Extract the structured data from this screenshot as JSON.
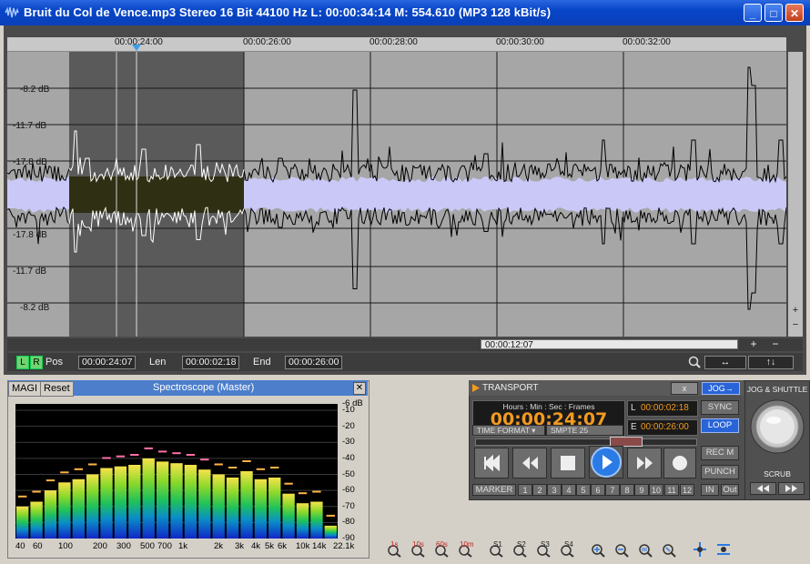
{
  "window": {
    "title": "Bruit du Col de Vence.mp3  Stereo 16 Bit 44100 Hz L: 00:00:34:14 M: 554.610  (MP3 128 kBit/s)",
    "minimize": "_",
    "maximize": "□",
    "close": "✕"
  },
  "ruler": {
    "ticks": [
      "00:00:24:00",
      "00:00:26:00",
      "00:00:28:00",
      "00:00:30:00",
      "00:00:32:00"
    ]
  },
  "waveform": {
    "db_labels": [
      "-8.2 dB",
      "-11.7 dB",
      "-17.8 dB",
      "-17.8 dB",
      "-11.7 dB",
      "-8.2 dB"
    ],
    "colors": {
      "background": "#a6a6a6",
      "selection": "#5a5a5a",
      "fill": "#c9c8f6",
      "selection_fill": "#2f2f14",
      "line": "#000000"
    }
  },
  "scroll": {
    "position": "00:00:12:07",
    "zoom_in": "+",
    "zoom_out": "−",
    "v_zoom_in": "+",
    "v_zoom_out": "−"
  },
  "infobar": {
    "left_channel": "L",
    "right_channel": "R",
    "pos_label": "Pos",
    "pos_value": "00:00:24:07",
    "len_label": "Len",
    "len_value": "00:00:02:18",
    "end_label": "End",
    "end_value": "00:00:26:00",
    "h_zoom": "↔",
    "v_zoom": "↑↓"
  },
  "spectroscope": {
    "tab_magi": "MAGI",
    "tab_reset": "Reset",
    "title": "Spectroscope (Master)",
    "close": "✕",
    "db_scale": [
      "-6 dB",
      "-10",
      "-20",
      "-30",
      "-40",
      "-50",
      "-60",
      "-70",
      "-80",
      "-90"
    ],
    "freq_labels": [
      "40",
      "60",
      "100",
      "200",
      "300",
      "500",
      "700",
      "1k",
      "2k",
      "3k",
      "4k",
      "5k",
      "6k",
      "10k",
      "14k",
      "22.1k"
    ],
    "levels_db": [
      -70,
      -67,
      -60,
      -55,
      -53,
      -50,
      -46,
      -45,
      -44,
      -40,
      -42,
      -43,
      -44,
      -47,
      -50,
      -52,
      -48,
      -53,
      -52,
      -62,
      -68,
      -67,
      -82
    ]
  },
  "transport": {
    "title": "TRANSPORT",
    "close": "x",
    "jog_button": "JOG→",
    "time_header": "Hours : Min : Sec : Frames",
    "time": "00:00:24:07",
    "time_format_label": "TIME FORMAT",
    "time_format_value": "SMPTE 25",
    "l_label": "L",
    "l_value": "00:00:02:18",
    "e_label": "E",
    "e_value": "00:00:26:00",
    "sync": "SYNC",
    "loop": "LOOP",
    "rec_m": "REC M",
    "punch": "PUNCH",
    "in": "IN",
    "out": "Out",
    "marker": "MARKER",
    "markers": [
      "1",
      "2",
      "3",
      "4",
      "5",
      "6",
      "7",
      "8",
      "9",
      "10",
      "11",
      "12"
    ]
  },
  "jog": {
    "title": "JOG & SHUTTLE",
    "scrub": "SCRUB"
  },
  "toolbar": {
    "items": [
      "1s",
      "10s",
      "60s",
      "10m",
      "S1",
      "S2",
      "S3",
      "S4"
    ]
  }
}
